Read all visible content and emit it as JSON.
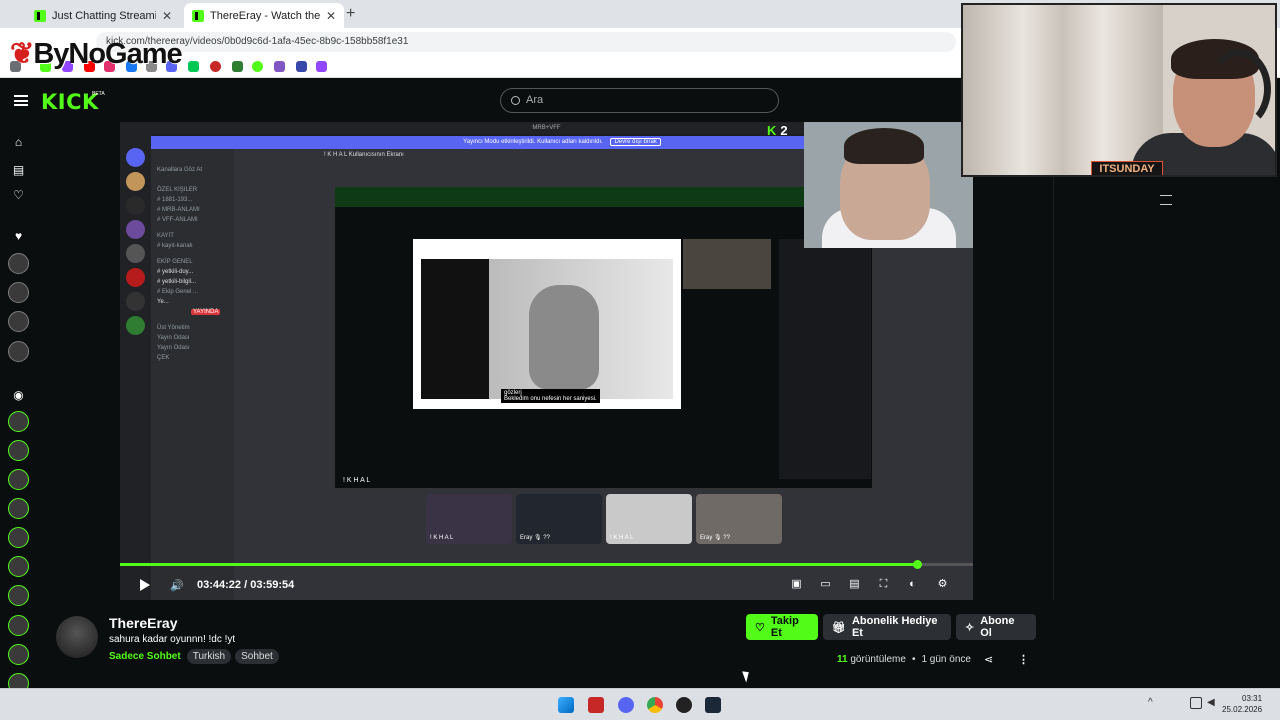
{
  "browser": {
    "tabs": [
      {
        "label": "Just Chatting Streaming - Live S"
      },
      {
        "label": "ThereEray - Watch the VOD on"
      }
    ],
    "new_tab": "+",
    "url": "kick.com/thereeray/videos/0b0d9c6d-1afa-45ec-8b9c-158bb58f1e31",
    "watermark_logo": "ByNoGame"
  },
  "header": {
    "logo": "KICK",
    "beta": "BETA",
    "search_placeholder": "Ara"
  },
  "video": {
    "discord_server": "MRB+VFF",
    "discord_notice": "Yayıncı Modu etkinleştirildi. Kullanıcı adları kaldırıldı.",
    "discord_notice_btn": "Devre dışı bırak",
    "discord_channel_title": "! K H A L Kullanıcısının Ekranı",
    "discord_channels": [
      "Kanallara Göz At",
      "ÖZEL KIŞILER",
      "# 1881-193...",
      "# MRB-ANLAMI",
      "# VFF-ANLAMI",
      "KAYIT",
      "# kayıt-kanalı",
      "EKİP GENEL",
      "# yetkili-duy...",
      "# yetkili-bilgil...",
      "# Ekip Genel ...",
      "Ye...",
      "Üst Yönetim",
      "Yayın Odası",
      "Yayın Odası",
      "ÇEK"
    ],
    "screen_label": "! K H A L",
    "meme_caption_line1": "gözlerj",
    "meme_caption_line2": "Bekledim onu nefesin her saniyesi.",
    "thumb_labels": [
      "! K H A L",
      "Eray 🎙 ??",
      "! K H A L",
      "Eray 🎙 ??"
    ],
    "live_badge": "YAYINDA",
    "overlay_kick_logo": "K",
    "overlay_kick_count": "2",
    "current_time": "03:44:22",
    "time_sep": "/",
    "duration": "03:59:54",
    "progress": 0.934
  },
  "facecam": {
    "name_tag": "ITSUNDAY"
  },
  "channel": {
    "name": "ThereEray",
    "title": "sahura kadar oyunnn! !dc !yt",
    "category": "Sadece Sohbet",
    "tags": [
      "Turkish",
      "Sohbet"
    ],
    "follow_label": "Takip Et",
    "gift_label": "Abonelik Hediye Et",
    "subscribe_label": "Abone Ol",
    "view_count": "11",
    "view_label": "görüntüleme",
    "bullet": "•",
    "time_ago": "1 gün önce"
  },
  "taskbar": {
    "time": "03:31",
    "date": "25.02.2026"
  },
  "colors": {
    "kick_green": "#53fc18",
    "background": "#0b0e0f",
    "button_dark": "#2c2f33",
    "discord_blurple": "#5865f2"
  }
}
